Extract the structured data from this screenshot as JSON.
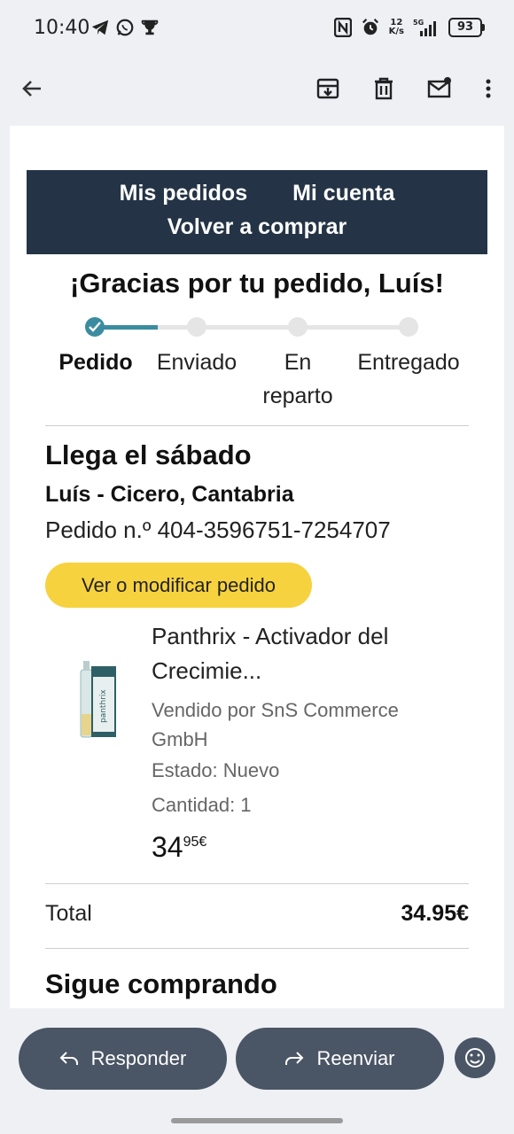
{
  "status_bar": {
    "time": "10:40",
    "net_speed_top": "12",
    "net_speed_bottom": "K/s",
    "network": "5G",
    "battery": "93"
  },
  "toolbar": {
    "back_icon": "arrow-left-icon",
    "archive_icon": "archive-icon",
    "delete_icon": "trash-icon",
    "mark_unread_icon": "mail-unread-icon",
    "more_icon": "more-vert-icon"
  },
  "email": {
    "nav": {
      "my_orders": "Mis pedidos",
      "my_account": "Mi cuenta",
      "buy_again": "Volver a comprar"
    },
    "thanks": "¡Gracias por tu pedido, Luís!",
    "progress": {
      "steps": [
        "Pedido",
        "Enviado",
        "En reparto",
        "Entregado"
      ],
      "current_step": 1,
      "accent": "#3b8ca0"
    },
    "arrival": "Llega el sábado",
    "ship_to": "Luís - Cicero, Cantabria",
    "order_number": "Pedido n.º 404-3596751-7254707",
    "view_button": "Ver o modificar pedido",
    "product": {
      "title": "Panthrix - Activador del Crecimie...",
      "seller": "Vendido por SnS Commerce GmbH",
      "state": "Estado: Nuevo",
      "quantity": "Cantidad: 1",
      "price_int": "34",
      "price_dec": "95€",
      "image_brand": "panthrix"
    },
    "total_label": "Total",
    "total_value": "34.95€",
    "keep_shopping": "Sigue comprando"
  },
  "actions": {
    "reply": "Responder",
    "forward": "Reenviar",
    "emoji_icon": "emoji-icon"
  },
  "colors": {
    "nav_bg": "#243446",
    "button_yellow": "#f7d23f",
    "action_bg": "#4a5565"
  }
}
